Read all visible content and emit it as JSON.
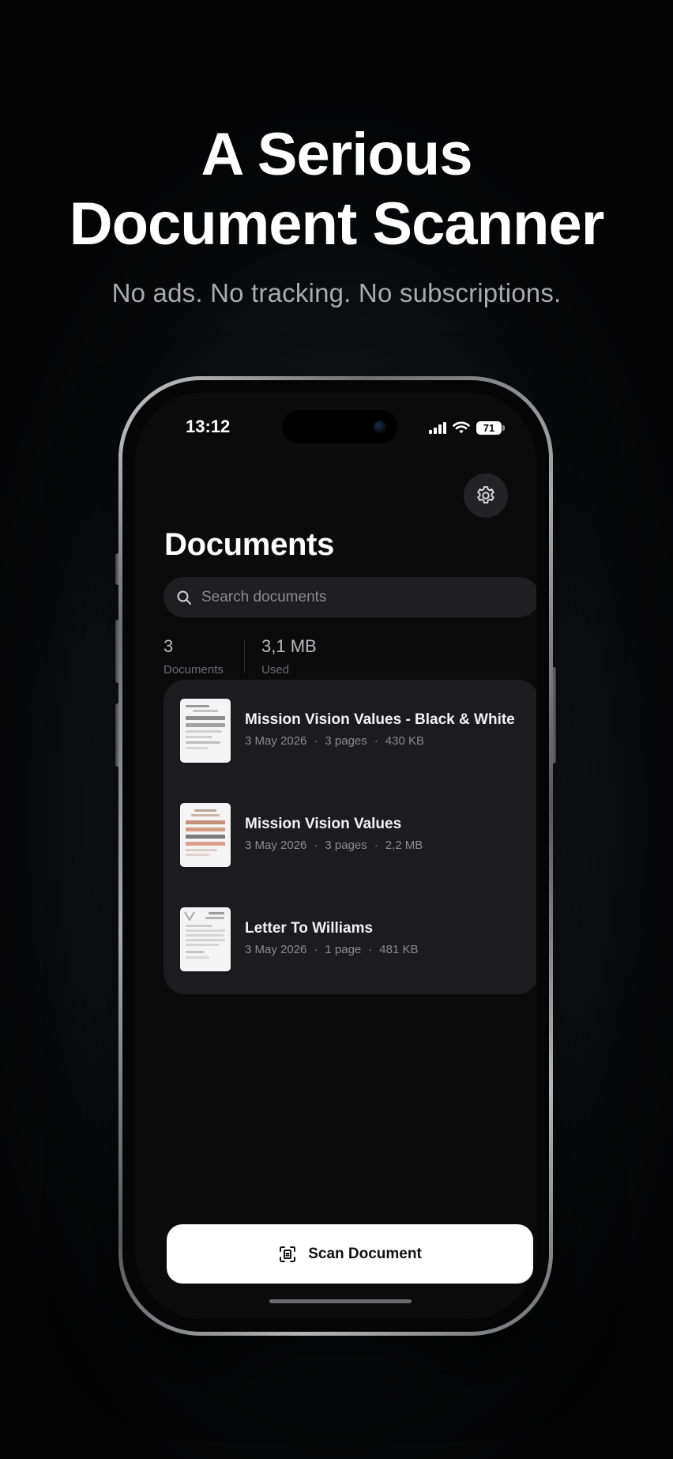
{
  "marketing": {
    "headline_line1": "A Serious",
    "headline_line2": "Document Scanner",
    "subheadline": "No ads. No tracking. No subscriptions."
  },
  "status_bar": {
    "time": "13:12",
    "battery": "71",
    "icons": [
      "signal-icon",
      "wifi-icon",
      "battery-icon"
    ]
  },
  "header": {
    "title": "Documents",
    "settings_icon": "gear-icon"
  },
  "search": {
    "placeholder": "Search documents",
    "icon": "search-icon"
  },
  "stats": [
    {
      "value": "3",
      "label": "Documents"
    },
    {
      "value": "3,1 MB",
      "label": "Used"
    }
  ],
  "documents": [
    {
      "name": "Mission Vision Values - Black & White",
      "date": "3 May 2026",
      "pages": "3 pages",
      "size": "430 KB"
    },
    {
      "name": "Mission Vision Values",
      "date": "3 May 2026",
      "pages": "3 pages",
      "size": "2,2 MB"
    },
    {
      "name": "Letter To Williams",
      "date": "3 May 2026",
      "pages": "1 page",
      "size": "481 KB"
    }
  ],
  "meta_separator": "·",
  "scan_button": {
    "label": "Scan Document",
    "icon": "document-scan-icon"
  },
  "colors": {
    "screen_background": "#0b0b0c",
    "card_background": "#1c1c1e",
    "primary_button": "#ffffff",
    "secondary_text": "#8a8a8f"
  }
}
